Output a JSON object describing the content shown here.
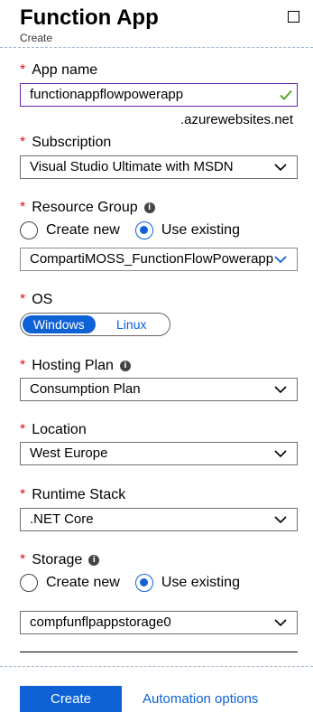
{
  "header": {
    "title": "Function App",
    "subtitle": "Create"
  },
  "required_mark": "*",
  "info_symbol": "i",
  "app_name": {
    "label": "App name",
    "value": "functionappflowpowerapp",
    "suffix": ".azurewebsites.net"
  },
  "subscription": {
    "label": "Subscription",
    "value": "Visual Studio Ultimate with MSDN"
  },
  "resource_group": {
    "label": "Resource Group",
    "option_new": "Create new",
    "option_existing": "Use existing",
    "selected": "Use existing",
    "value": "CompartiMOSS_FunctionFlowPowerapps"
  },
  "os": {
    "label": "OS",
    "options": [
      "Windows",
      "Linux"
    ],
    "selected": "Windows"
  },
  "hosting_plan": {
    "label": "Hosting Plan",
    "value": "Consumption Plan"
  },
  "location": {
    "label": "Location",
    "value": "West Europe"
  },
  "runtime_stack": {
    "label": "Runtime Stack",
    "value": ".NET Core"
  },
  "storage": {
    "label": "Storage",
    "option_new": "Create new",
    "option_existing": "Use existing",
    "selected": "Use existing",
    "value": "compfunflpappstorage0"
  },
  "footer": {
    "create_label": "Create",
    "automation_label": "Automation options"
  },
  "colors": {
    "accent": "#0f62d6",
    "required": "#e00b1c",
    "valid": "#5ba52e",
    "focus_border": "#6b1fa7"
  }
}
